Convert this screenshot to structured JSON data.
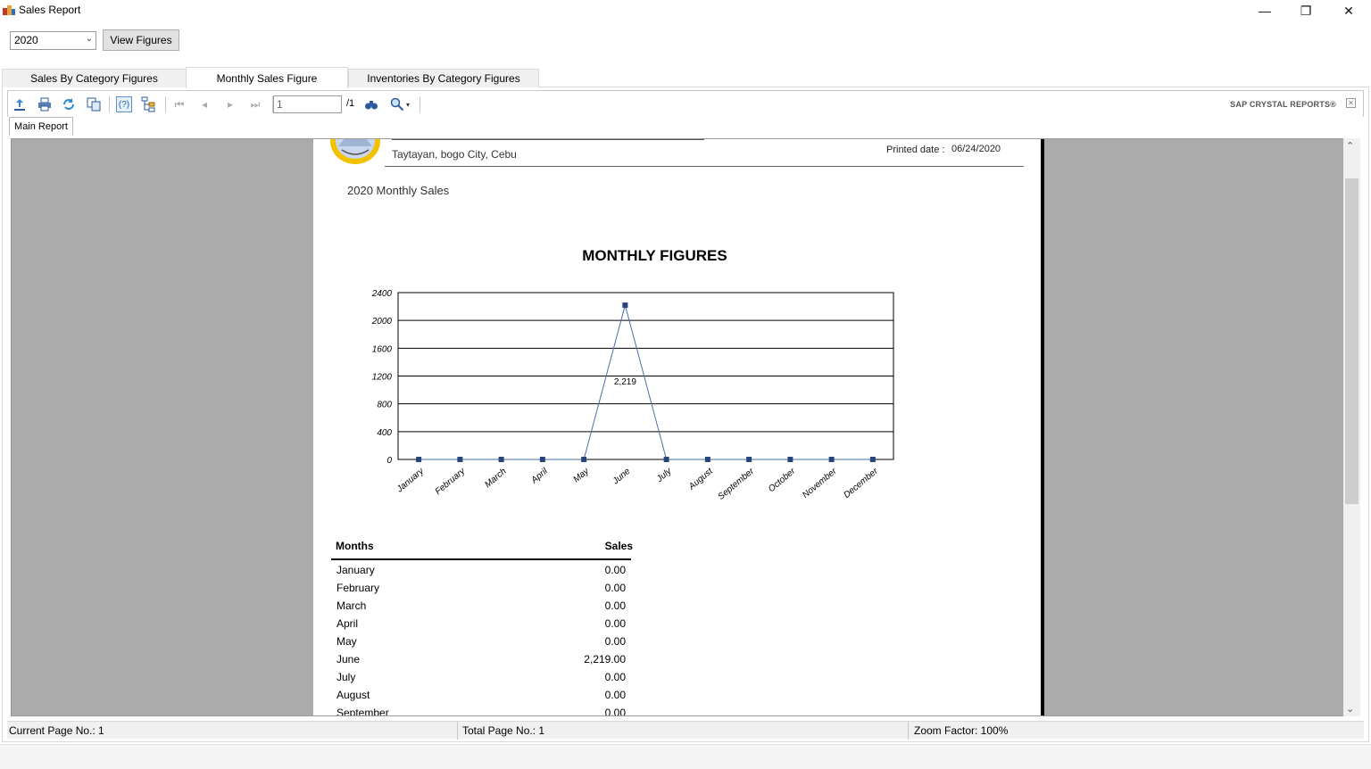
{
  "window": {
    "title": "Sales Report",
    "minimize_glyph": "—",
    "restore_glyph": "❐",
    "close_glyph": "✕"
  },
  "controls": {
    "year_value": "2020",
    "view_button": "View Figures"
  },
  "tabs": [
    {
      "label": "Sales By Category Figures",
      "active": false
    },
    {
      "label": "Monthly Sales Figure",
      "active": true
    },
    {
      "label": "Inventories By Category Figures",
      "active": false
    }
  ],
  "viewer_toolbar": {
    "page_value": "1",
    "page_total": "/1",
    "brand": "SAP CRYSTAL REPORTS®",
    "icons": [
      "export-icon",
      "print-icon",
      "refresh-icon",
      "copy-icon",
      "help-icon",
      "group-tree-icon",
      "first-page-icon",
      "prev-page-icon",
      "next-page-icon",
      "last-page-icon",
      "find-icon",
      "zoom-icon"
    ]
  },
  "report_tab": "Main Report",
  "report": {
    "address": "Taytayan, bogo City, Cebu",
    "printed_label": "Printed date :",
    "printed_date": "06/24/2020",
    "subtitle": "2020 Monthly Sales"
  },
  "chart_data": {
    "type": "line",
    "title": "MONTHLY FIGURES",
    "categories": [
      "January",
      "February",
      "March",
      "April",
      "May",
      "June",
      "July",
      "August",
      "September",
      "October",
      "November",
      "December"
    ],
    "values": [
      0,
      0,
      0,
      0,
      0,
      2219,
      0,
      0,
      0,
      0,
      0,
      0
    ],
    "data_labels": {
      "June": "2,219"
    },
    "ylim": [
      0,
      2400
    ],
    "yticks": [
      0,
      400,
      800,
      1200,
      1600,
      2000,
      2400
    ],
    "grid": true,
    "line_color": "#4a6fa5",
    "marker_color": "#27457a"
  },
  "table": {
    "header_months": "Months",
    "header_sales": "Sales",
    "rows": [
      {
        "month": "January",
        "sales": "0.00"
      },
      {
        "month": "February",
        "sales": "0.00"
      },
      {
        "month": "March",
        "sales": "0.00"
      },
      {
        "month": "April",
        "sales": "0.00"
      },
      {
        "month": "May",
        "sales": "0.00"
      },
      {
        "month": "June",
        "sales": "2,219.00"
      },
      {
        "month": "July",
        "sales": "0.00"
      },
      {
        "month": "August",
        "sales": "0.00"
      },
      {
        "month": "September",
        "sales": "0.00"
      }
    ]
  },
  "status": {
    "current_page": "Current Page No.: 1",
    "total_page": "Total Page No.: 1",
    "zoom": "Zoom Factor: 100%"
  }
}
